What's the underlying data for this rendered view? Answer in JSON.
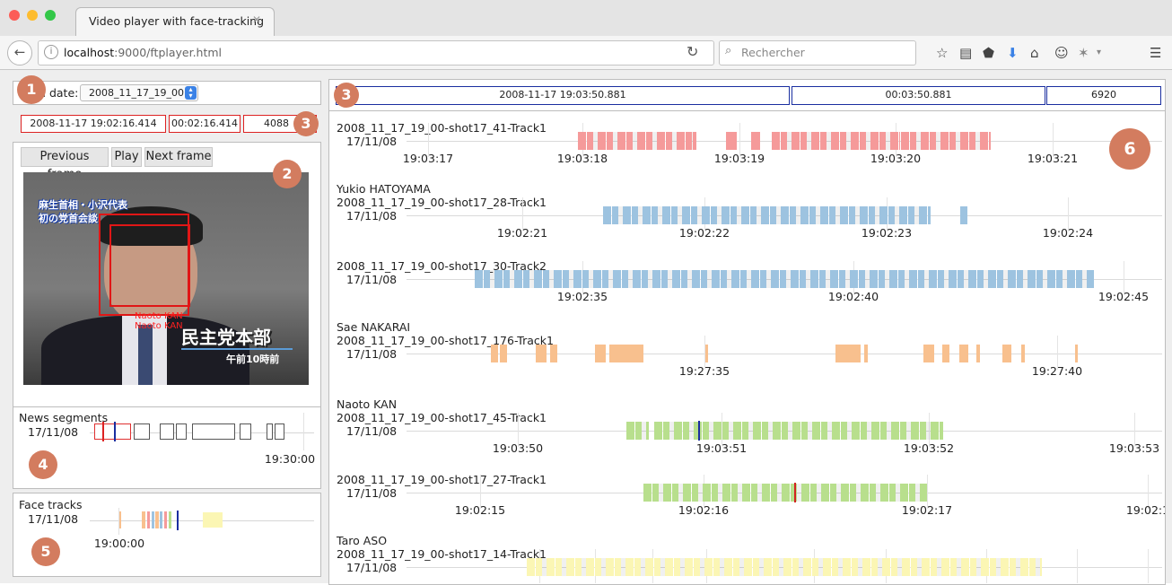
{
  "browser": {
    "tab_title": "Video player with face-tracking",
    "tab_close": "✕",
    "url_host": "localhost",
    "url_rest": ":9000/ftplayer.html",
    "search_placeholder": "Rechercher"
  },
  "left": {
    "load_date_label": "Load date:",
    "load_date_value": "2008_11_17_19_00",
    "current_datetime": "2008-11-17 19:02:16.414",
    "current_time": "00:02:16.414",
    "current_frame": "4088",
    "buttons": {
      "prev": "Previous frame",
      "play": "Play",
      "next": "Next frame"
    },
    "video_overlay": {
      "caption_line1": "麻生首相・小沢代表",
      "caption_line2": "初の党首会談",
      "face_label_1": "Naoto KAN",
      "face_label_2": "Naoto KAN",
      "lower_title": "民主党本部",
      "lower_sub": "午前10時前"
    },
    "news_segments": {
      "title": "News segments",
      "date": "17/11/08",
      "tick": "19:30:00"
    },
    "face_tracks": {
      "title": "Face tracks",
      "date": "17/11/08",
      "tick": "19:00:00"
    }
  },
  "right": {
    "datetime": "2008-11-17 19:03:50.881",
    "time": "00:03:50.881",
    "frame": "6920"
  },
  "badges": [
    "1",
    "2",
    "3",
    "3",
    "4",
    "5",
    "6"
  ],
  "tracks": [
    {
      "person": "",
      "name": "2008_11_17_19_00-shot17_41-Track1",
      "date": "17/11/08",
      "ticks": [
        "19:03:17",
        "19:03:18",
        "19:03:19",
        "19:03:20",
        "19:03:21"
      ]
    },
    {
      "person": "Yukio HATOYAMA",
      "name": "2008_11_17_19_00-shot17_28-Track1",
      "date": "17/11/08",
      "ticks": [
        "19:02:21",
        "19:02:22",
        "19:02:23",
        "19:02:24"
      ]
    },
    {
      "person": "",
      "name": "2008_11_17_19_00-shot17_30-Track2",
      "date": "17/11/08",
      "ticks": [
        "19:02:35",
        "19:02:40",
        "19:02:45"
      ]
    },
    {
      "person": "Sae NAKARAI",
      "name": "2008_11_17_19_00-shot17_176-Track1",
      "date": "17/11/08",
      "ticks": [
        "19:27:35",
        "19:27:40"
      ]
    },
    {
      "person": "Naoto KAN",
      "name": "2008_11_17_19_00-shot17_45-Track1",
      "date": "17/11/08",
      "ticks": [
        "19:03:50",
        "19:03:51",
        "19:03:52",
        "19:03:53"
      ]
    },
    {
      "person": "",
      "name": "2008_11_17_19_00-shot17_27-Track1",
      "date": "17/11/08",
      "ticks": [
        "19:02:15",
        "19:02:16",
        "19:02:17",
        "19:02:1"
      ]
    },
    {
      "person": "Taro ASO",
      "name": "2008_11_17_19_00-shot17_14-Track1",
      "date": "17/11/08",
      "ticks": []
    }
  ],
  "colors": {
    "red_track": "#f59a9a",
    "blue_track": "#9dc3e0",
    "orange_track": "#f8c08e",
    "green_track": "#b8df8d",
    "yellow_track": "#fbf6b4",
    "cursor_blue": "#1a2ea0",
    "cursor_red": "#d22222",
    "badge": "#d37c5f"
  }
}
